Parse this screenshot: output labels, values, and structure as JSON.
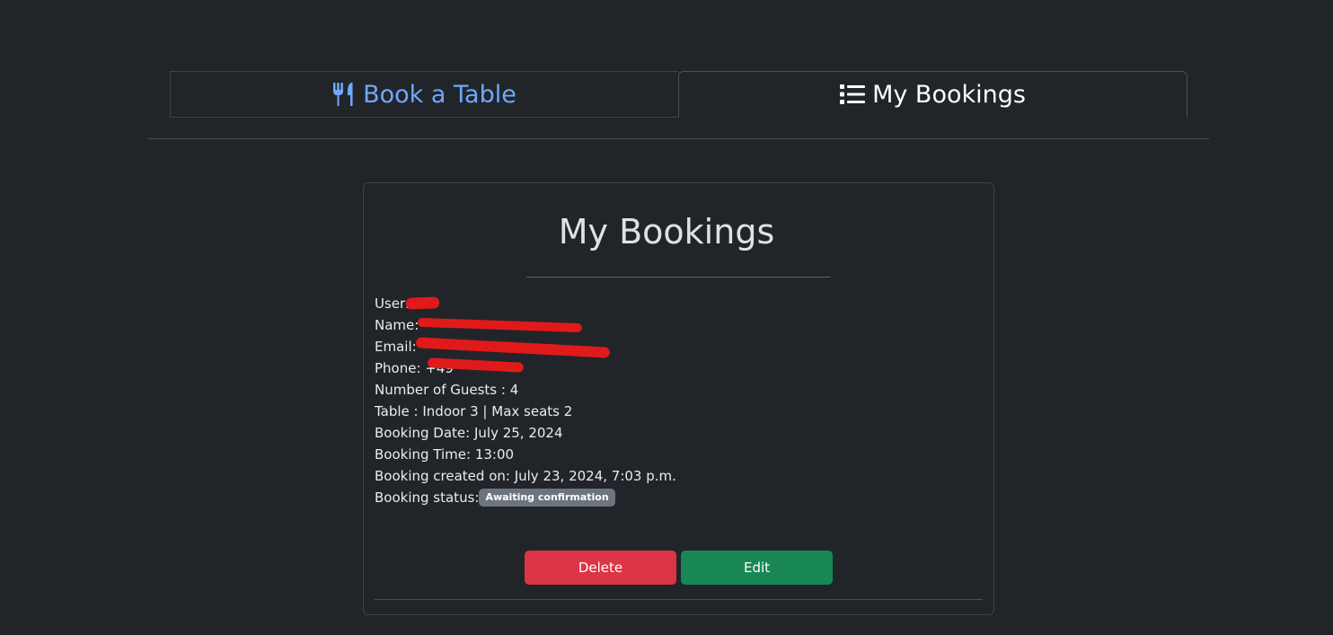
{
  "tabs": {
    "book": {
      "label": "Book a Table",
      "icon": "utensils-icon"
    },
    "bookings": {
      "label": "My Bookings",
      "icon": "list-icon"
    }
  },
  "card": {
    "title": "My Bookings",
    "fields": {
      "user_label": "User:",
      "name_label": "Name:",
      "email_label": "Email:",
      "phone_label": "Phone:",
      "phone_value": "+49 ",
      "guests": "Number of Guests : 4",
      "table": "Table : Indoor 3 | Max seats 2",
      "date": "Booking Date: July 25, 2024",
      "time": "Booking Time: 13:00",
      "created": "Booking created on: July 23, 2024, 7:03 p.m.",
      "status_label": "Booking status:",
      "status_value": "Awaiting confirmation"
    },
    "buttons": {
      "delete": "Delete",
      "edit": "Edit"
    }
  },
  "colors": {
    "background": "#212529",
    "tab_link": "#6ea8fe",
    "delete": "#dc3545",
    "edit": "#198754",
    "badge": "#6c757d"
  }
}
